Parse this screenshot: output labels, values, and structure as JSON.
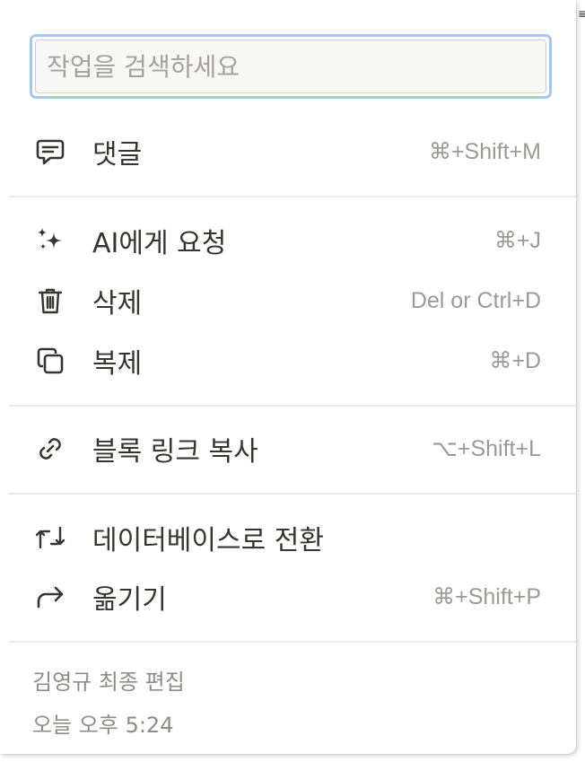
{
  "search": {
    "placeholder": "작업을 검색하세요",
    "value": ""
  },
  "menu": {
    "items": [
      {
        "label": "댓글",
        "shortcut": "⌘+Shift+M",
        "icon": "comment-icon"
      },
      {
        "label": "AI에게 요청",
        "shortcut": "⌘+J",
        "icon": "sparkles-icon"
      },
      {
        "label": "삭제",
        "shortcut": "Del or Ctrl+D",
        "icon": "trash-icon"
      },
      {
        "label": "복제",
        "shortcut": "⌘+D",
        "icon": "duplicate-icon"
      },
      {
        "label": "블록 링크 복사",
        "shortcut": "⌥+Shift+L",
        "icon": "link-icon"
      },
      {
        "label": "데이터베이스로 전환",
        "shortcut": "",
        "icon": "convert-icon"
      },
      {
        "label": "옮기기",
        "shortcut": "⌘+Shift+P",
        "icon": "move-arrow-icon"
      }
    ]
  },
  "footer": {
    "edited_by": "김영규 최종 편집",
    "edited_time": "오늘 오후 5:24"
  },
  "colors": {
    "text": "#37352f",
    "muted": "#9b9a97",
    "focus_ring": "#a6c8ee",
    "divider": "#ecebea"
  }
}
